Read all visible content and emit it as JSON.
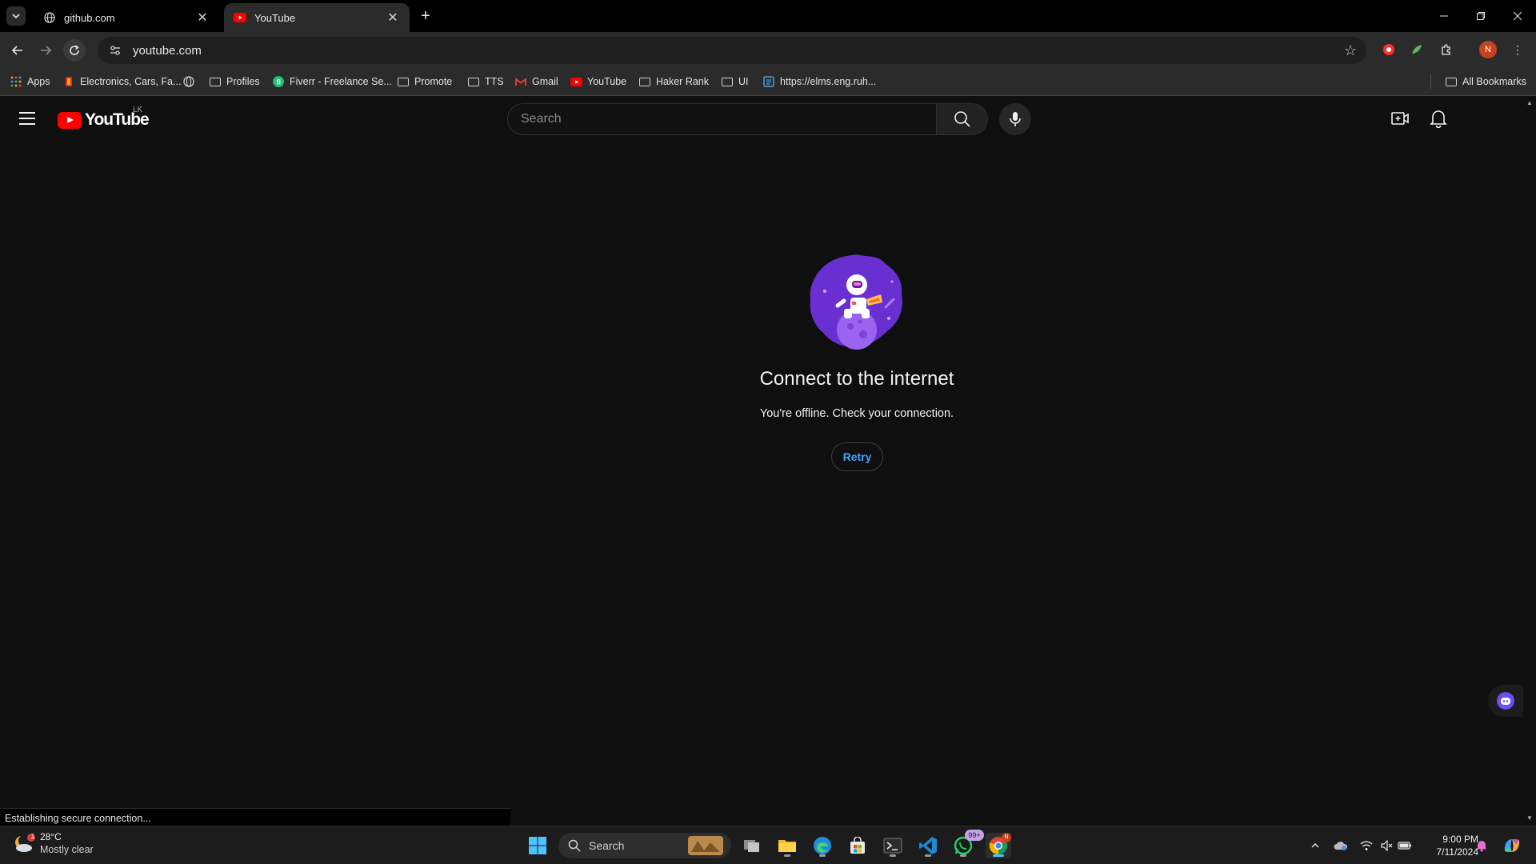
{
  "browser": {
    "tabs": [
      {
        "title": "github.com",
        "icon": "globe-icon"
      },
      {
        "title": "YouTube",
        "icon": "youtube-icon"
      }
    ],
    "url": "youtube.com",
    "bookmarks": [
      {
        "label": "Apps",
        "icon": "apps-grid-icon"
      },
      {
        "label": "Electronics, Cars, Fa...",
        "icon": "aliexpress-icon"
      },
      {
        "label": "",
        "icon": "globe-icon"
      },
      {
        "label": "Profiles",
        "icon": "folder-icon"
      },
      {
        "label": "Fiverr - Freelance Se...",
        "icon": "fiverr-icon"
      },
      {
        "label": "Promote",
        "icon": "folder-icon"
      },
      {
        "label": "TTS",
        "icon": "folder-icon"
      },
      {
        "label": "Gmail",
        "icon": "gmail-icon"
      },
      {
        "label": "YouTube",
        "icon": "youtube-icon"
      },
      {
        "label": "Haker Rank",
        "icon": "folder-icon"
      },
      {
        "label": "UI",
        "icon": "folder-icon"
      },
      {
        "label": "https://elms.eng.ruh...",
        "icon": "elms-icon"
      }
    ],
    "all_bookmarks": "All Bookmarks",
    "profile_initial": "N",
    "status_text": "Establishing secure connection..."
  },
  "youtube": {
    "logo_text": "YouTube",
    "country_code": "LK",
    "search_placeholder": "Search",
    "offline_title": "Connect to the internet",
    "offline_message": "You're offline. Check your connection.",
    "retry_label": "Retry"
  },
  "taskbar": {
    "weather_temp": "28°C",
    "weather_condition": "Mostly clear",
    "weather_badge": "1",
    "search_label": "Search",
    "whatsapp_badge": "99+",
    "chrome_badge": "N",
    "time": "9:00 PM",
    "date": "7/11/2024"
  },
  "colors": {
    "youtube_red": "#ff0000",
    "link_blue": "#3ea6ff",
    "background": "#0f0f0f"
  }
}
